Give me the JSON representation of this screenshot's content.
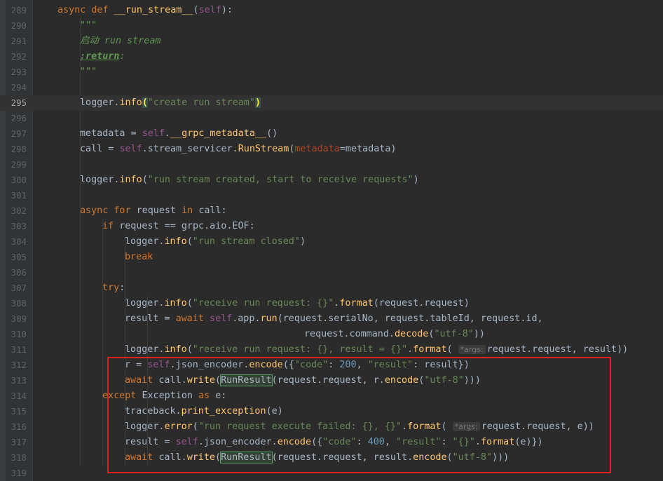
{
  "editor": {
    "first_line": 289,
    "current_line": 295,
    "lines": [
      {
        "n": "289",
        "ind": 1,
        "t": [
          {
            "c": "kw",
            "v": "async def "
          },
          {
            "c": "fn",
            "v": "__run_stream__"
          },
          {
            "c": "txt",
            "v": "("
          },
          {
            "c": "self",
            "v": "self"
          },
          {
            "c": "txt",
            "v": "):"
          }
        ]
      },
      {
        "n": "290",
        "ind": 2,
        "t": [
          {
            "c": "doc",
            "v": "\"\"\""
          }
        ]
      },
      {
        "n": "291",
        "ind": 2,
        "t": [
          {
            "c": "doc",
            "v": "启动 run stream"
          }
        ]
      },
      {
        "n": "292",
        "ind": 2,
        "t": [
          {
            "c": "tag",
            "v": ":return"
          },
          {
            "c": "doc",
            "v": ":"
          }
        ]
      },
      {
        "n": "293",
        "ind": 2,
        "t": [
          {
            "c": "doc",
            "v": "\"\"\""
          }
        ]
      },
      {
        "n": "294",
        "ind": 0,
        "t": []
      },
      {
        "n": "295",
        "ind": 2,
        "t": [
          {
            "c": "txt",
            "v": "logger."
          },
          {
            "c": "mc",
            "v": "info"
          },
          {
            "c": "brace",
            "v": "("
          },
          {
            "c": "str",
            "v": "\"create run stream\""
          },
          {
            "c": "brace",
            "v": ")"
          }
        ]
      },
      {
        "n": "296",
        "ind": 0,
        "t": []
      },
      {
        "n": "297",
        "ind": 2,
        "t": [
          {
            "c": "txt",
            "v": "metadata = "
          },
          {
            "c": "self",
            "v": "self"
          },
          {
            "c": "txt",
            "v": "."
          },
          {
            "c": "mc",
            "v": "__grpc_metadata__"
          },
          {
            "c": "txt",
            "v": "()"
          }
        ]
      },
      {
        "n": "298",
        "ind": 2,
        "t": [
          {
            "c": "txt",
            "v": "call = "
          },
          {
            "c": "self",
            "v": "self"
          },
          {
            "c": "txt",
            "v": ".stream_servicer."
          },
          {
            "c": "mc",
            "v": "RunStream"
          },
          {
            "c": "txt",
            "v": "("
          },
          {
            "c": "par",
            "v": "metadata"
          },
          {
            "c": "txt",
            "v": "=metadata)"
          }
        ]
      },
      {
        "n": "299",
        "ind": 0,
        "t": []
      },
      {
        "n": "300",
        "ind": 2,
        "t": [
          {
            "c": "txt",
            "v": "logger."
          },
          {
            "c": "mc",
            "v": "info"
          },
          {
            "c": "txt",
            "v": "("
          },
          {
            "c": "str",
            "v": "\"run stream created, start to receive requests\""
          },
          {
            "c": "txt",
            "v": ")"
          }
        ]
      },
      {
        "n": "301",
        "ind": 0,
        "t": []
      },
      {
        "n": "302",
        "ind": 2,
        "t": [
          {
            "c": "kw",
            "v": "async for "
          },
          {
            "c": "txt",
            "v": "request "
          },
          {
            "c": "kw",
            "v": "in "
          },
          {
            "c": "txt",
            "v": "call:"
          }
        ]
      },
      {
        "n": "303",
        "ind": 3,
        "t": [
          {
            "c": "kw",
            "v": "if "
          },
          {
            "c": "txt",
            "v": "request == grpc.aio.EOF:"
          }
        ]
      },
      {
        "n": "304",
        "ind": 4,
        "t": [
          {
            "c": "txt",
            "v": "logger."
          },
          {
            "c": "mc",
            "v": "info"
          },
          {
            "c": "txt",
            "v": "("
          },
          {
            "c": "str",
            "v": "\"run stream closed\""
          },
          {
            "c": "txt",
            "v": ")"
          }
        ]
      },
      {
        "n": "305",
        "ind": 4,
        "t": [
          {
            "c": "kw",
            "v": "break"
          }
        ]
      },
      {
        "n": "306",
        "ind": 0,
        "t": []
      },
      {
        "n": "307",
        "ind": 3,
        "t": [
          {
            "c": "kw",
            "v": "try"
          },
          {
            "c": "txt",
            "v": ":"
          }
        ]
      },
      {
        "n": "308",
        "ind": 4,
        "t": [
          {
            "c": "txt",
            "v": "logger."
          },
          {
            "c": "mc",
            "v": "info"
          },
          {
            "c": "txt",
            "v": "("
          },
          {
            "c": "str",
            "v": "\"receive run request: {}\""
          },
          {
            "c": "txt",
            "v": "."
          },
          {
            "c": "mc",
            "v": "format"
          },
          {
            "c": "txt",
            "v": "(request.request)"
          }
        ]
      },
      {
        "n": "309",
        "ind": 4,
        "t": [
          {
            "c": "txt",
            "v": "result = "
          },
          {
            "c": "kw",
            "v": "await "
          },
          {
            "c": "self",
            "v": "self"
          },
          {
            "c": "txt",
            "v": ".app."
          },
          {
            "c": "mc",
            "v": "run"
          },
          {
            "c": "txt",
            "v": "(request.serialNo, request.tableId, request.id,"
          }
        ]
      },
      {
        "n": "310",
        "ind": 11,
        "t": [
          {
            "c": "txt",
            "v": "request.command."
          },
          {
            "c": "mc",
            "v": "decode"
          },
          {
            "c": "txt",
            "v": "("
          },
          {
            "c": "str",
            "v": "\"utf-8\""
          },
          {
            "c": "txt",
            "v": "))"
          }
        ]
      },
      {
        "n": "311",
        "ind": 4,
        "t": [
          {
            "c": "txt",
            "v": "logger."
          },
          {
            "c": "mc",
            "v": "info"
          },
          {
            "c": "txt",
            "v": "("
          },
          {
            "c": "str",
            "v": "\"receive run request: {}, result = {}\""
          },
          {
            "c": "txt",
            "v": "."
          },
          {
            "c": "mc",
            "v": "format"
          },
          {
            "c": "txt",
            "v": "( "
          },
          {
            "c": "hint",
            "v": "*args:"
          },
          {
            "c": "txt",
            "v": "request.request, result))"
          }
        ]
      },
      {
        "n": "312",
        "ind": 4,
        "t": [
          {
            "c": "txt",
            "v": "r = "
          },
          {
            "c": "self",
            "v": "self"
          },
          {
            "c": "txt",
            "v": ".json_encoder."
          },
          {
            "c": "mc",
            "v": "encode"
          },
          {
            "c": "txt",
            "v": "({"
          },
          {
            "c": "str",
            "v": "\"code\""
          },
          {
            "c": "txt",
            "v": ": "
          },
          {
            "c": "num",
            "v": "200"
          },
          {
            "c": "txt",
            "v": ", "
          },
          {
            "c": "str",
            "v": "\"result\""
          },
          {
            "c": "txt",
            "v": ": result})"
          }
        ]
      },
      {
        "n": "313",
        "ind": 4,
        "t": [
          {
            "c": "kw",
            "v": "await "
          },
          {
            "c": "txt",
            "v": "call."
          },
          {
            "c": "mc",
            "v": "write"
          },
          {
            "c": "txt",
            "v": "("
          },
          {
            "c": "hl",
            "v": "RunResult"
          },
          {
            "c": "txt",
            "v": "(request.request, r."
          },
          {
            "c": "mc",
            "v": "encode"
          },
          {
            "c": "txt",
            "v": "("
          },
          {
            "c": "str",
            "v": "\"utf-8\""
          },
          {
            "c": "txt",
            "v": ")))"
          }
        ]
      },
      {
        "n": "314",
        "ind": 3,
        "t": [
          {
            "c": "kw",
            "v": "except "
          },
          {
            "c": "txt",
            "v": "Exception "
          },
          {
            "c": "kw",
            "v": "as "
          },
          {
            "c": "txt",
            "v": "e:"
          }
        ]
      },
      {
        "n": "315",
        "ind": 4,
        "t": [
          {
            "c": "txt",
            "v": "traceback."
          },
          {
            "c": "mc",
            "v": "print_exception"
          },
          {
            "c": "txt",
            "v": "(e)"
          }
        ]
      },
      {
        "n": "316",
        "ind": 4,
        "t": [
          {
            "c": "txt",
            "v": "logger."
          },
          {
            "c": "mc",
            "v": "error"
          },
          {
            "c": "txt",
            "v": "("
          },
          {
            "c": "str",
            "v": "\"run request execute failed: {}, {}\""
          },
          {
            "c": "txt",
            "v": "."
          },
          {
            "c": "mc",
            "v": "format"
          },
          {
            "c": "txt",
            "v": "( "
          },
          {
            "c": "hint",
            "v": "*args:"
          },
          {
            "c": "txt",
            "v": "request.request, e))"
          }
        ]
      },
      {
        "n": "317",
        "ind": 4,
        "t": [
          {
            "c": "txt",
            "v": "result = "
          },
          {
            "c": "self",
            "v": "self"
          },
          {
            "c": "txt",
            "v": ".json_encoder."
          },
          {
            "c": "mc",
            "v": "encode"
          },
          {
            "c": "txt",
            "v": "({"
          },
          {
            "c": "str",
            "v": "\"code\""
          },
          {
            "c": "txt",
            "v": ": "
          },
          {
            "c": "num",
            "v": "400"
          },
          {
            "c": "txt",
            "v": ", "
          },
          {
            "c": "str",
            "v": "\"result\""
          },
          {
            "c": "txt",
            "v": ": "
          },
          {
            "c": "str",
            "v": "\"{}\""
          },
          {
            "c": "txt",
            "v": "."
          },
          {
            "c": "mc",
            "v": "format"
          },
          {
            "c": "txt",
            "v": "(e)})"
          }
        ]
      },
      {
        "n": "318",
        "ind": 4,
        "t": [
          {
            "c": "kw",
            "v": "await "
          },
          {
            "c": "txt",
            "v": "call."
          },
          {
            "c": "mc",
            "v": "write"
          },
          {
            "c": "txt",
            "v": "("
          },
          {
            "c": "hl",
            "v": "RunResult"
          },
          {
            "c": "txt",
            "v": "(request.request, result."
          },
          {
            "c": "mc",
            "v": "encode"
          },
          {
            "c": "txt",
            "v": "("
          },
          {
            "c": "str",
            "v": "\"utf-8\""
          },
          {
            "c": "txt",
            "v": ")))"
          }
        ]
      },
      {
        "n": "319",
        "ind": 0,
        "t": []
      }
    ]
  },
  "annotation": {
    "color": "#e51e1e"
  }
}
